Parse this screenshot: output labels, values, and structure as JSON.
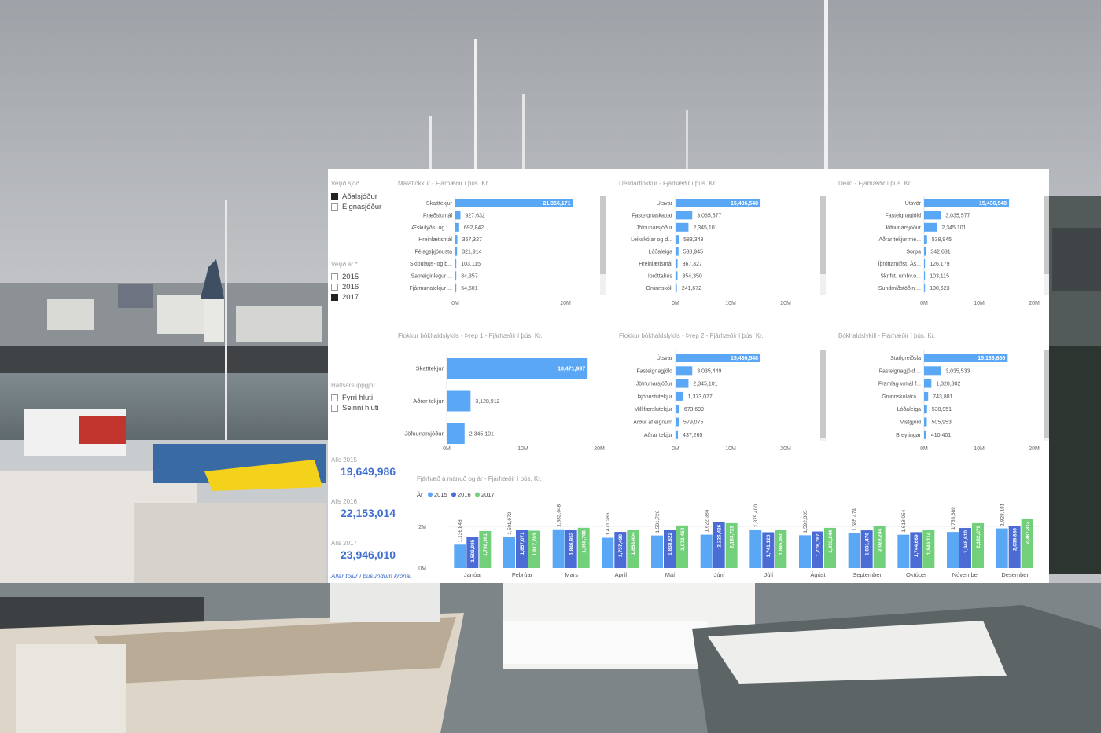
{
  "slicers": {
    "fund": {
      "title": "Veljið sjóð",
      "options": [
        {
          "label": "Aðalsjóður",
          "checked": true
        },
        {
          "label": "Eignasjóður",
          "checked": false
        }
      ]
    },
    "year": {
      "title": "Veljið ár *",
      "options": [
        {
          "label": "2015",
          "checked": false
        },
        {
          "label": "2016",
          "checked": false
        },
        {
          "label": "2017",
          "checked": true
        }
      ]
    },
    "half": {
      "title": "Hálfsársuppgjör",
      "options": [
        {
          "label": "Fyrri hluti",
          "checked": false
        },
        {
          "label": "Seinni hluti",
          "checked": false
        }
      ]
    }
  },
  "kpis": [
    {
      "label": "Alls 2015",
      "value": "19,649,986"
    },
    {
      "label": "Alls 2016",
      "value": "22,153,014"
    },
    {
      "label": "Alls 2017",
      "value": "23,946,010"
    }
  ],
  "footnote": "Allar tölur í þúsundum króna.",
  "colors": {
    "bar": "#5aa7f5",
    "y2015": "#5aa7f5",
    "y2016": "#4a6cd4",
    "y2017": "#72d07a",
    "kpi": "#3f6fcf",
    "scrollbar": "#c8c8c8"
  },
  "chart_data": [
    {
      "type": "bar",
      "orientation": "horizontal",
      "title": "Málaflokkur - Fjárhæðir í þús. Kr.",
      "categories": [
        "Skatttekjur",
        "Fræðslumál",
        "Æskulýðs- og í...",
        "Hreinlætismál",
        "Félagsþjónusta",
        "Skipulags- og b...",
        "Sameiginlegur ...",
        "Fjármunatekjur ..."
      ],
      "values": [
        21356171,
        927632,
        692842,
        367327,
        321914,
        103115,
        84357,
        64601
      ],
      "labels": [
        "21,356,171",
        "927,632",
        "692,842",
        "367,327",
        "321,914",
        "103,115",
        "84,357",
        "64,601"
      ],
      "xmax": 25000000,
      "ticks": [
        0,
        20000000
      ],
      "tick_labels": [
        "0M",
        "20M"
      ],
      "scrollbar": true
    },
    {
      "type": "bar",
      "orientation": "horizontal",
      "title": "Deildarflokkur - Fjárhæðir í þús. Kr.",
      "categories": [
        "Útsvar",
        "Fasteignaskattar",
        "Jöfnunarsjóður",
        "Leikskólar og d...",
        "Lóðaleiga",
        "Hreinlætismál",
        "Íþróttahús",
        "Grunnskóli"
      ],
      "values": [
        15436548,
        3035577,
        2345101,
        583343,
        538945,
        367327,
        354350,
        241672
      ],
      "labels": [
        "15,436,548",
        "3,035,577",
        "2,345,101",
        "583,343",
        "538,945",
        "367,327",
        "354,350",
        "241,672"
      ],
      "xmax": 25000000,
      "ticks": [
        0,
        10000000,
        20000000
      ],
      "tick_labels": [
        "0M",
        "10M",
        "20M"
      ],
      "scrollbar": true
    },
    {
      "type": "bar",
      "orientation": "horizontal",
      "title": "Deild - Fjárhæðir í þús. Kr.",
      "categories": [
        "Útsvör",
        "Fasteignagjöld",
        "Jöfnunarsjóður",
        "Aðrar tekjur me...",
        "Sorpa",
        "Íþróttamiðst. Ás...",
        "Skrifst. umhv.o...",
        "Sundmiðstöðin ..."
      ],
      "values": [
        15436548,
        3035577,
        2345101,
        538945,
        342631,
        126179,
        103115,
        100623
      ],
      "labels": [
        "15,436,548",
        "3,035,577",
        "2,345,101",
        "538,945",
        "342,631",
        "126,179",
        "103,115",
        "100,623"
      ],
      "xmax": 25000000,
      "ticks": [
        0,
        10000000,
        20000000
      ],
      "tick_labels": [
        "0M",
        "10M",
        "20M"
      ],
      "scrollbar": true
    },
    {
      "type": "bar",
      "orientation": "horizontal",
      "title": "Flokkur bókhaldslykils - Þrep 1 - Fjárhæðir í þús. Kr.",
      "categories": [
        "Skatttekjur",
        "Aðrar tekjur",
        "Jöfnunarsjóður"
      ],
      "values": [
        18471997,
        3128912,
        2345101
      ],
      "labels": [
        "18,471,997",
        "3,128,912",
        "2,345,101"
      ],
      "xmax": 20000000,
      "ticks": [
        0,
        10000000,
        20000000
      ],
      "tick_labels": [
        "0M",
        "10M",
        "20M"
      ],
      "scrollbar": false
    },
    {
      "type": "bar",
      "orientation": "horizontal",
      "title": "Flokkur bókhaldslykils - Þrep 2 - Fjárhæðir í þús. Kr.",
      "categories": [
        "Útsvar",
        "Fasteignagjöld",
        "Jöfnunarsjóður",
        "Þjónustutekjur",
        "Millifærslutekjur",
        "Arður af eignum",
        "Aðrar tekjur"
      ],
      "values": [
        15436548,
        3035449,
        2345101,
        1373077,
        673699,
        579075,
        437265
      ],
      "labels": [
        "15,436,548",
        "3,035,449",
        "2,345,101",
        "1,373,077",
        "673,699",
        "579,075",
        "437,265"
      ],
      "xmax": 25000000,
      "ticks": [
        0,
        10000000,
        20000000
      ],
      "tick_labels": [
        "0M",
        "10M",
        "20M"
      ],
      "scrollbar": true
    },
    {
      "type": "bar",
      "orientation": "horizontal",
      "title": "Bókhaldslykill - Fjárhæðir í þús. Kr.",
      "categories": [
        "Staðgreiðsla",
        "Fasteignagjöld ...",
        "Framlag v/mál f...",
        "Grunnskólafra...",
        "Lóðaleiga",
        "Vistgjöld",
        "Breytingar"
      ],
      "values": [
        15189886,
        3035533,
        1328302,
        743881,
        538951,
        505953,
        410401
      ],
      "labels": [
        "15,189,886",
        "3,035,533",
        "1,328,302",
        "743,881",
        "538,951",
        "505,953",
        "410,401"
      ],
      "xmax": 25000000,
      "ticks": [
        0,
        10000000,
        20000000
      ],
      "tick_labels": [
        "0M",
        "10M",
        "20M"
      ],
      "scrollbar": true
    },
    {
      "type": "bar",
      "orientation": "vertical",
      "title": "Fjárhæð á mánuð og ár - Fjárhæðir í þús. Kr.",
      "legend_title": "Ár",
      "categories": [
        "Janúar",
        "Febrúar",
        "Mars",
        "Apríl",
        "Maí",
        "Júní",
        "Júlí",
        "Ágúst",
        "September",
        "Október",
        "Nóvember",
        "Desember"
      ],
      "series": [
        {
          "name": "2015",
          "values": [
            1136848,
            1501972,
            1882648,
            1471286,
            1581726,
            1622384,
            1875400,
            1592305,
            1685474,
            1618054,
            1753689,
            1928181
          ],
          "labels": [
            "1,136,848",
            "1,501,972",
            "1,882,648",
            "1,471,286",
            "1,581,726",
            "1,622,384",
            "1,875,400",
            "1,592,305",
            "1,685,474",
            "1,618,054",
            "1,753,689",
            "1,928,181"
          ]
        },
        {
          "name": "2016",
          "values": [
            1503985,
            1857071,
            1846953,
            1757490,
            1838822,
            2226426,
            1741120,
            1776767,
            1831470,
            1744669,
            1948610,
            2059836
          ],
          "labels": [
            "1,503,985",
            "1,857,071",
            "1,846,953",
            "1,757,490",
            "1,838,822",
            "2,226,426",
            "1,741,120",
            "1,776,767",
            "1,831,470",
            "1,744,669",
            "1,948,610",
            "2,059,836"
          ]
        },
        {
          "name": "2017",
          "values": [
            1798961,
            1817703,
            1956706,
            1858404,
            2072450,
            2183723,
            1845950,
            1953244,
            2029244,
            1849114,
            2182679,
            2387312
          ],
          "labels": [
            "1,798,961",
            "1,817,703",
            "1,956,706",
            "1,858,404",
            "2,072,450",
            "2,183,723",
            "1,845,950",
            "1,953,244",
            "2,029,244",
            "1,849,114",
            "2,182,679",
            "2,387,312"
          ]
        }
      ],
      "ymax": 2600000,
      "ticks": [
        0,
        2000000
      ],
      "tick_labels": [
        "0M",
        "2M"
      ]
    }
  ]
}
